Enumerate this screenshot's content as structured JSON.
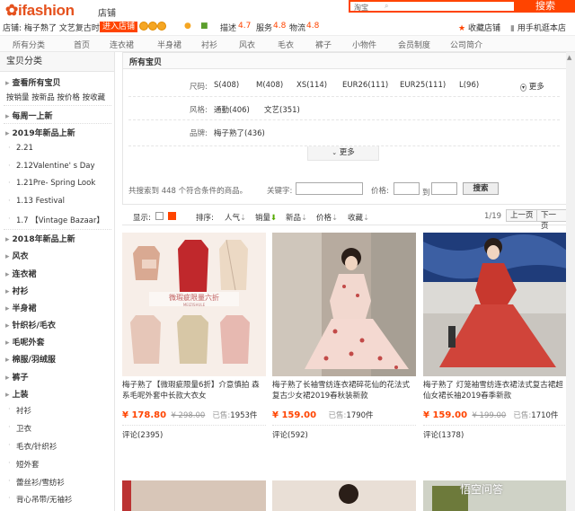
{
  "header": {
    "logo_text": "ifashion",
    "shop_label": "店铺",
    "search_scope": "淘宝",
    "search_icon": "search-icon",
    "search_button": "搜索",
    "shop_prefix": "店铺:",
    "shop_name": "梅子熟了 文艺复古时",
    "enter_shop": "进入店铺",
    "score_desc_label": "描述",
    "score_desc": "4.7",
    "score_service_label": "服务",
    "score_service": "4.8",
    "score_logistics_label": "物流",
    "score_logistics": "4.8",
    "favorite_shop": "收藏店铺",
    "mobile_shop": "用手机逛本店"
  },
  "nav": [
    "所有分类",
    "首页",
    "连衣裙",
    "半身裙",
    "衬衫",
    "风衣",
    "毛衣",
    "裤子",
    "小物件",
    "会员制度",
    "公司简介"
  ],
  "sidebar": {
    "title": "宝贝分类",
    "view_all": "查看所有宝贝",
    "sort_links": "按销量 按新品 按价格 按收藏",
    "items": [
      {
        "label": "每周一上新",
        "type": "main"
      },
      {
        "label": "2019年新品上新",
        "type": "main"
      },
      {
        "label": "2.21",
        "type": "sub"
      },
      {
        "label": "2.12Valentine' s Day",
        "type": "sub"
      },
      {
        "label": "1.21Pre- Spring Look",
        "type": "sub"
      },
      {
        "label": "1.13 Festival",
        "type": "sub"
      },
      {
        "label": "1.7 【Vintage Bazaar】",
        "type": "sub"
      },
      {
        "label": "2018年新品上新",
        "type": "main"
      },
      {
        "label": "风衣",
        "type": "main"
      },
      {
        "label": "连衣裙",
        "type": "main"
      },
      {
        "label": "衬衫",
        "type": "main"
      },
      {
        "label": "半身裙",
        "type": "main"
      },
      {
        "label": "针织衫/毛衣",
        "type": "main"
      },
      {
        "label": "毛呢外套",
        "type": "main"
      },
      {
        "label": "棉服/羽绒服",
        "type": "main"
      },
      {
        "label": "裤子",
        "type": "main"
      },
      {
        "label": "上装",
        "type": "main"
      },
      {
        "label": "衬衫",
        "type": "sub"
      },
      {
        "label": "卫衣",
        "type": "sub"
      },
      {
        "label": "毛衣/针织衫",
        "type": "sub"
      },
      {
        "label": "短外套",
        "type": "sub"
      },
      {
        "label": "蕾丝衫/雪纺衫",
        "type": "sub"
      },
      {
        "label": "背心吊带/无袖衫",
        "type": "sub"
      }
    ]
  },
  "filter": {
    "title": "所有宝贝",
    "size_label": "尺码:",
    "sizes": [
      "S(408)",
      "M(408)",
      "XS(114)",
      "EUR26(111)",
      "EUR25(111)",
      "L(96)"
    ],
    "more_label": "更多",
    "style_label": "风格:",
    "styles": [
      "通勤(406)",
      "文艺(351)"
    ],
    "brand_label": "品牌:",
    "brands": [
      "梅子熟了(436)"
    ],
    "more_tab": "更多",
    "result_text": "共搜索到 448 个符合条件的商品。",
    "keyword_label": "关键字:",
    "price_label": "价格:",
    "to_label": "到",
    "search_button": "搜索"
  },
  "sortbar": {
    "display_label": "显示:",
    "sort_label": "排序:",
    "options": [
      "人气",
      "销量",
      "新品",
      "价格",
      "收藏"
    ],
    "page_info": "1/19",
    "prev": "上一页",
    "next": "下一页"
  },
  "products": [
    {
      "title": "梅子熟了【微瑕疵限量6折】介意慎拍 森系毛呢外套中长款大衣女",
      "price": "¥ 178.80",
      "old_price": "¥ 298.00",
      "sold_label": "已售:",
      "sold": "1953件",
      "reviews": "评论(2395)",
      "banner": "微瑕疵限量六折",
      "banner_sub": "MEIZISHULE"
    },
    {
      "title": "梅子熟了长袖雪纺连衣裙碎花仙的花法式复古少女裙2019春秋装新款",
      "price": "¥ 159.00",
      "old_price": "",
      "sold_label": "已售:",
      "sold": "1790件",
      "reviews": "评论(592)"
    },
    {
      "title": "梅子熟了 灯笼袖雪纺连衣裙法式复古裙超仙女裙长袖2019春季新款",
      "price": "¥ 159.00",
      "old_price": "¥ 199.00",
      "sold_label": "已售:",
      "sold": "1710件",
      "reviews": "评论(1378)"
    }
  ],
  "watermark": "悟空问答",
  "colors": {
    "accent": "#ff4400",
    "price": "#ff4400"
  }
}
